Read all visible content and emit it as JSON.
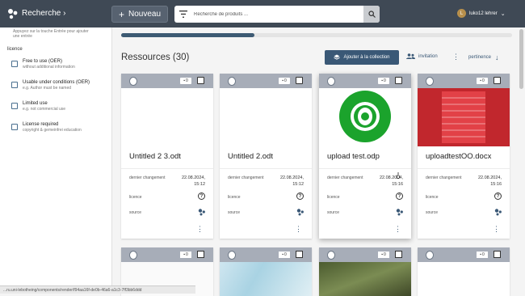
{
  "topbar": {
    "brand": "Recherche",
    "new_button": "Nouveau",
    "search_placeholder": "Recherche de produits ...",
    "user_initial": "L",
    "user_name": "luko12 lehrer"
  },
  "sidebar": {
    "top_note": "Appuyez sur la touche Entrée pour ajouter une entrée",
    "licence_heading": "licence",
    "licences": [
      {
        "title": "Free to use (OER)",
        "subtitle": "without additional information"
      },
      {
        "title": "Usable under conditions (OER)",
        "subtitle": "e.g. Author must be named"
      },
      {
        "title": "Limited use",
        "subtitle": "e.g. not commercial use"
      },
      {
        "title": "License required",
        "subtitle": "copyright & gemeinfrei education"
      }
    ]
  },
  "main": {
    "progress": 0.34,
    "title": "Ressources (30)",
    "add_collection": "Ajouter à la collection",
    "invitation": "invitation",
    "sort_label": "pertinence"
  },
  "labels": {
    "date_label": "dernier changement",
    "license_label": "licence",
    "source_label": "source"
  },
  "cards": [
    {
      "name": "Untitled 2 3.odt",
      "badge": "0",
      "date": "22.08.2024,",
      "time": "15:12",
      "icon": "document-icon"
    },
    {
      "name": "Untitled 2.odt",
      "badge": "0",
      "date": "22.08.2024,",
      "time": "15:12",
      "icon": "document-icon"
    },
    {
      "name": "upload test.odp",
      "badge": "0",
      "date": "22.08.2024,",
      "time": "15:16",
      "icon": "layers-icon"
    },
    {
      "name": "uploadtestOO.docx",
      "badge": "0",
      "date": "22.08.2024,",
      "time": "15:16",
      "icon": "word-icon"
    }
  ],
  "row2_badges": [
    "0",
    "0",
    "0",
    "0"
  ],
  "status_url": "...ru.uni-lebotheing/components/render/f94aa16f-de0b-46a6-a1c3-7ff3bb6ddd",
  "colors": {
    "topbar": "#3f4955",
    "accent": "#3a5876",
    "card_header": "#a7adb8",
    "cucumber_green": "#1ba32c",
    "word_red": "#c1272d"
  }
}
